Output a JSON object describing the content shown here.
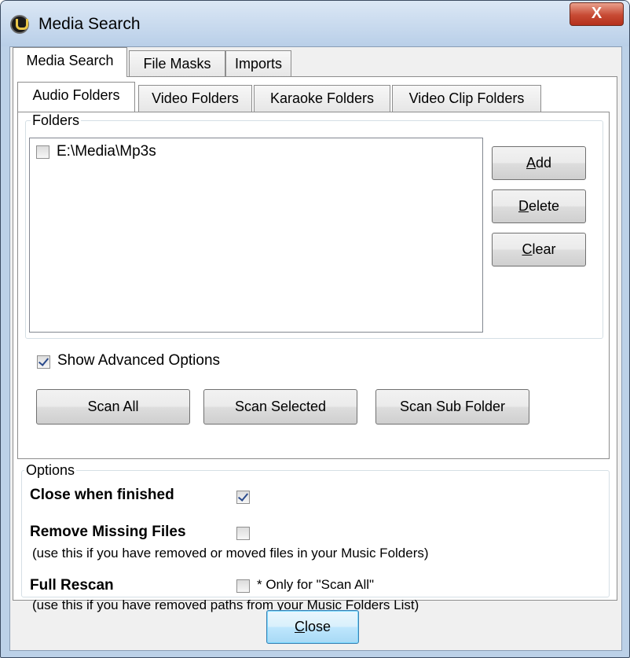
{
  "window": {
    "title": "Media Search",
    "close_glyph": "X"
  },
  "outer_tabs": [
    "Media Search",
    "File Masks",
    "Imports"
  ],
  "inner_tabs": [
    "Audio Folders",
    "Video Folders",
    "Karaoke Folders",
    "Video Clip Folders"
  ],
  "folders": {
    "group_label": "Folders",
    "items": [
      {
        "path": "E:\\Media\\Mp3s",
        "checked": false
      }
    ],
    "buttons": {
      "add": {
        "accel": "A",
        "rest": "dd"
      },
      "delete": {
        "accel": "D",
        "rest": "elete"
      },
      "clear": {
        "accel": "C",
        "rest": "lear"
      }
    }
  },
  "advanced": {
    "label": "Show Advanced Options",
    "checked": true
  },
  "scan_buttons": {
    "all": "Scan All",
    "selected": "Scan Selected",
    "sub_folder": "Scan Sub Folder"
  },
  "options": {
    "group_label": "Options",
    "close_when_finished": {
      "label": "Close when finished",
      "checked": true
    },
    "remove_missing": {
      "label": "Remove Missing Files",
      "checked": false,
      "note": "(use this if you have removed or moved files in your Music Folders)"
    },
    "full_rescan": {
      "label": "Full Rescan",
      "checked": false,
      "hint": "* Only for \"Scan All\"",
      "note": "(use this if you have removed paths from your Music Folders List)"
    }
  },
  "footer": {
    "close": {
      "accel": "C",
      "rest": "lose"
    }
  }
}
